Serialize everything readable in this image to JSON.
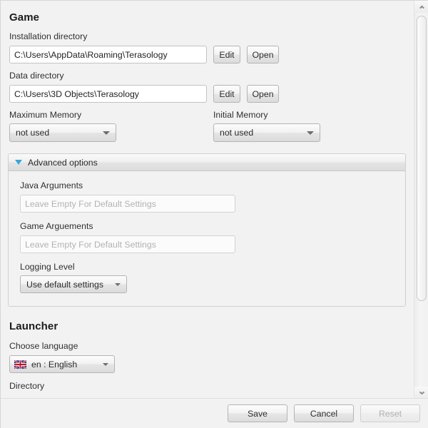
{
  "game_section": {
    "heading": "Game",
    "install_dir": {
      "label": "Installation directory",
      "value": "C:\\Users\\AppData\\Roaming\\Terasology",
      "edit_label": "Edit",
      "open_label": "Open"
    },
    "data_dir": {
      "label": "Data directory",
      "value": "C:\\Users\\3D Objects\\Terasology",
      "edit_label": "Edit",
      "open_label": "Open"
    },
    "max_memory": {
      "label": "Maximum Memory",
      "value": "not used"
    },
    "initial_memory": {
      "label": "Initial Memory",
      "value": "not used"
    }
  },
  "advanced": {
    "title": "Advanced options",
    "expanded_icon": "triangle-down-icon",
    "java_args": {
      "label": "Java Arguments",
      "value": "",
      "placeholder": "Leave Empty For Default Settings"
    },
    "game_args": {
      "label": "Game Arguements",
      "value": "",
      "placeholder": "Leave Empty For Default Settings"
    },
    "logging_level": {
      "label": "Logging Level",
      "value": "Use default settings"
    }
  },
  "launcher_section": {
    "heading": "Launcher",
    "language": {
      "label": "Choose language",
      "value": "en : English",
      "flag_icon": "union-jack-flag-icon"
    },
    "next_label_partial": "Directory"
  },
  "scrollbar": {
    "up_icon": "chevron-up-icon",
    "down_icon": "chevron-down-icon"
  },
  "button_bar": {
    "save_label": "Save",
    "cancel_label": "Cancel",
    "reset_label": "Reset",
    "reset_disabled": true
  },
  "colors": {
    "background": "#f2f2f2",
    "accent_triangle": "#37a8d8",
    "text": "#2b2b2b",
    "placeholder": "#b2b2b2",
    "disabled_text": "#b0b0b0"
  }
}
